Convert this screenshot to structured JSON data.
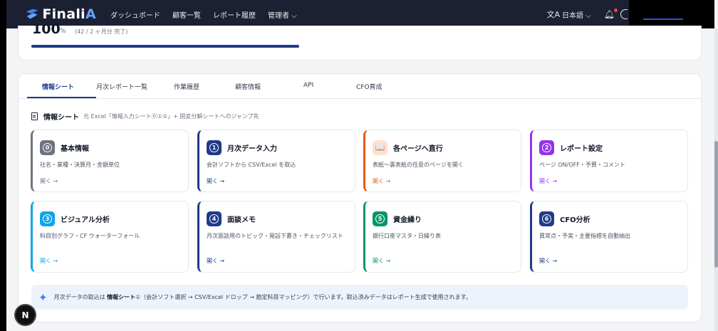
{
  "nav": {
    "logo": {
      "brand": "Finali",
      "accent": "A"
    },
    "links": [
      "ダッシュボード",
      "顧客一覧",
      "レポート履歴",
      "管理者 ⌵"
    ],
    "language": "日本語 ⌵",
    "language_icon": "translate-icon",
    "bell_icon": "bell-icon"
  },
  "progress": {
    "percent_label": "100",
    "unit": "%",
    "detail": "(42 / 2 ヶ月分 完了)",
    "fraction": 1.0
  },
  "tabs": [
    "情報シート",
    "月次レポート一覧",
    "作業履歴",
    "顧客情報",
    "API",
    "CFO育成"
  ],
  "section": {
    "title": "情報シート",
    "description": "元 Excel「情報入力シート⓪①②」+ 固変分解シートへのジャンプ先"
  },
  "tiles": [
    {
      "badge": "0",
      "title": "基本情報",
      "desc": "社名・業種・決算月・金額単位",
      "open": "開く →",
      "color": "#6b7280"
    },
    {
      "badge": "1",
      "title": "月次データ入力",
      "desc": "会計ソフトから CSV/Excel を取込",
      "open": "開く →",
      "color": "#1e3a8a"
    },
    {
      "badge": "📖",
      "title": "各ページへ直行",
      "desc": "表紙〜裏表紙の任意のページを開く",
      "open": "開く →",
      "color": "#ea580c"
    },
    {
      "badge": "2",
      "title": "レポート設定",
      "desc": "ページ ON/OFF・予算・コメント",
      "open": "開く →",
      "color": "#9333ea"
    },
    {
      "badge": "3",
      "title": "ビジュアル分析",
      "desc": "科目別グラフ・CF ウォーターフォール",
      "open": "開く →",
      "color": "#0ea5e9"
    },
    {
      "badge": "4",
      "title": "面談メモ",
      "desc": "月次面談用のトピック・発話下書き・チェックリスト",
      "open": "開く →",
      "color": "#1e3a8a"
    },
    {
      "badge": "5",
      "title": "資金繰り",
      "desc": "銀行口座マスタ・日繰り表",
      "open": "開く →",
      "color": "#059669"
    },
    {
      "badge": "6",
      "title": "CFO分析",
      "desc": "異常点・予実・主要指標を自動抽出",
      "open": "開く →",
      "color": "#1e3a8a"
    }
  ],
  "info": {
    "prefix": "月次データの取込は ",
    "bold": "情報シート",
    "suffix": "①（会計ソフト選択 → CSV/Excel ドロップ → 勘定科目マッピング）で行います。取込済みデータはレポート生成で使用されます。"
  },
  "floating_button": "N"
}
